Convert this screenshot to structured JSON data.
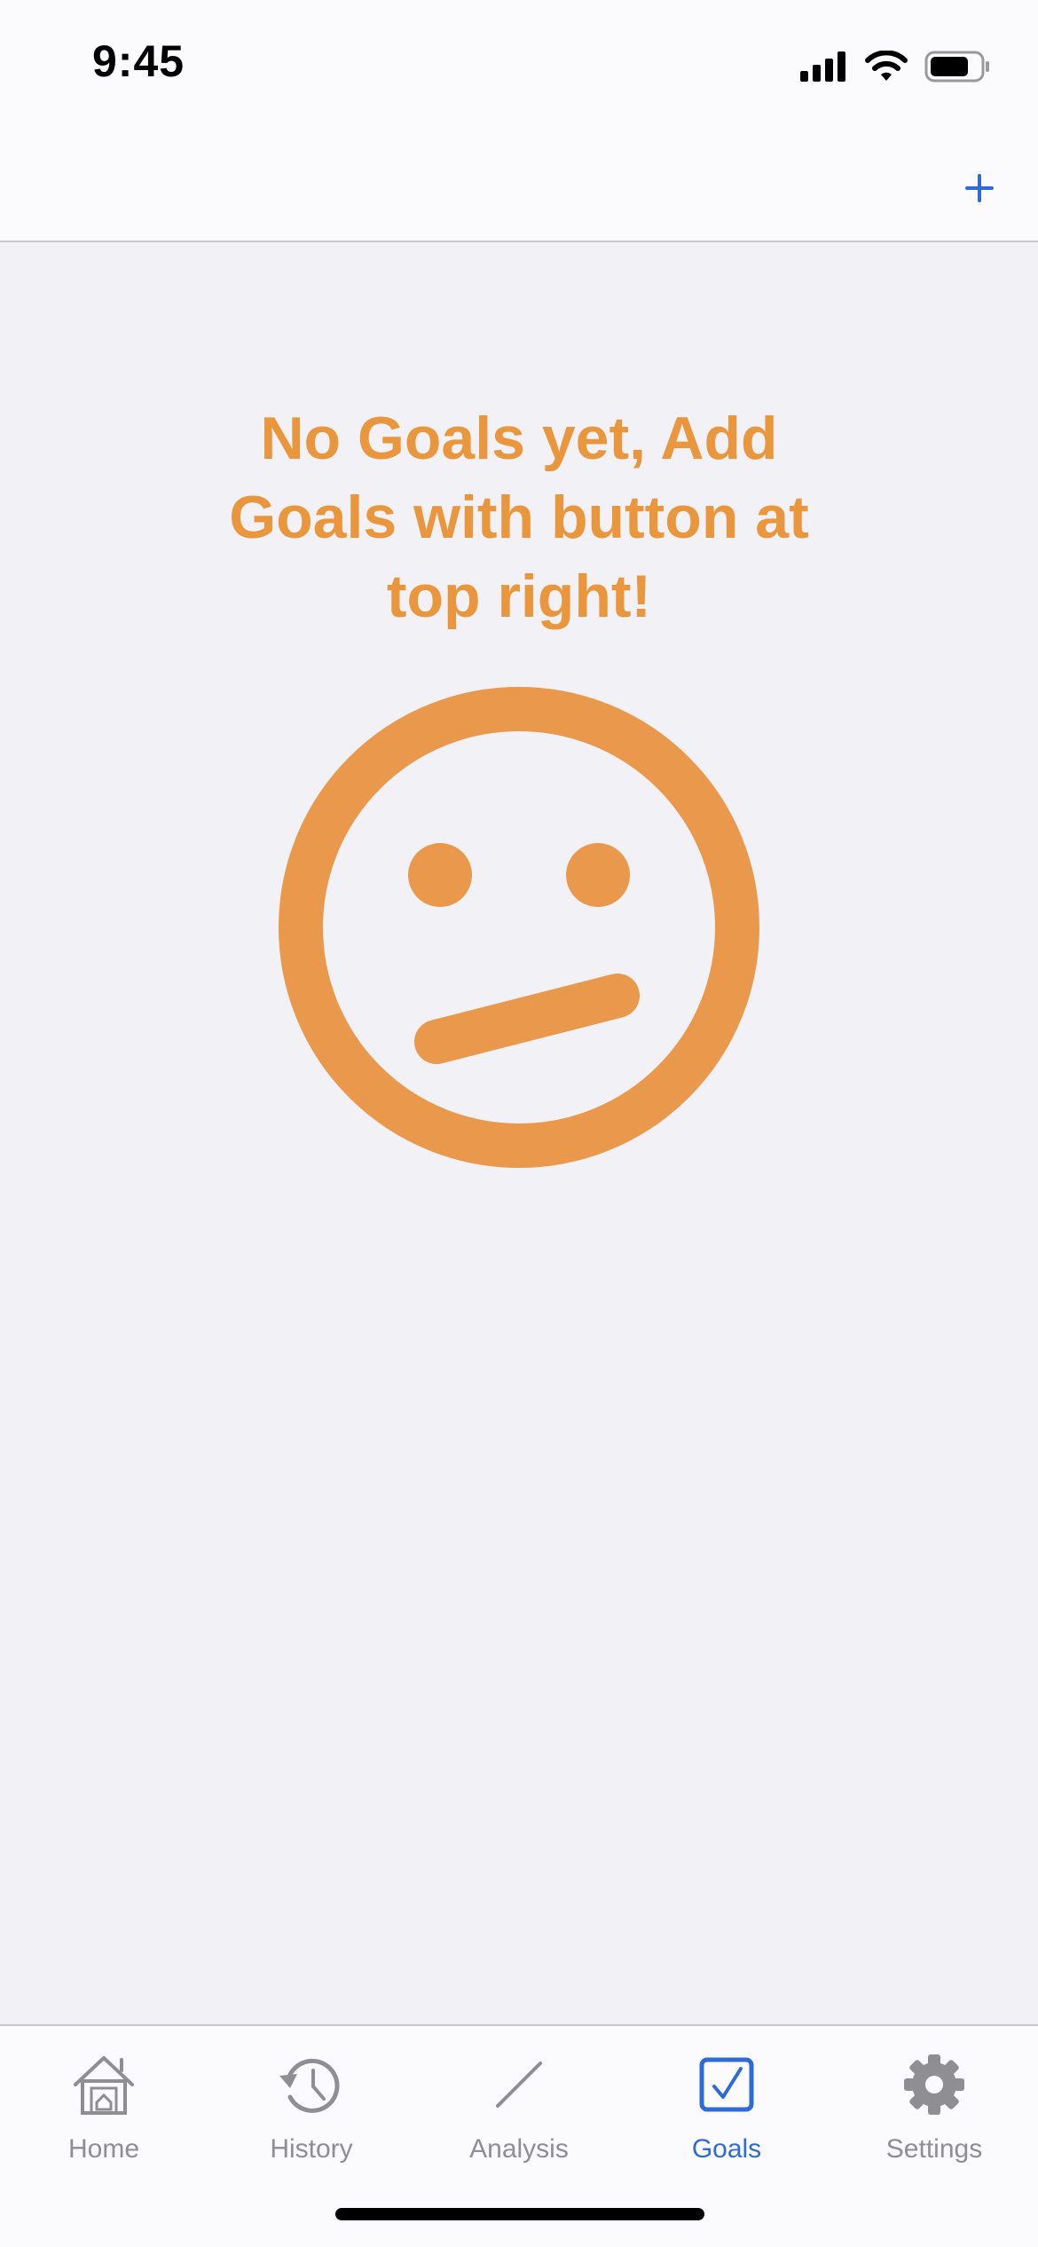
{
  "status_bar": {
    "time": "9:45",
    "icons": [
      "cellular-signal-icon",
      "wifi-icon",
      "battery-icon"
    ]
  },
  "nav_bar": {
    "add_button_icon": "plus-icon"
  },
  "empty_state": {
    "message": "No Goals yet, Add Goals with button at top right!",
    "icon": "confused-face-icon"
  },
  "tab_bar": {
    "tabs": [
      {
        "label": "Home",
        "icon": "house-icon",
        "active": false
      },
      {
        "label": "History",
        "icon": "clock-history-icon",
        "active": false
      },
      {
        "label": "Analysis",
        "icon": "line-chart-icon",
        "active": false
      },
      {
        "label": "Goals",
        "icon": "checkbox-icon",
        "active": true
      },
      {
        "label": "Settings",
        "icon": "gear-icon",
        "active": false
      }
    ]
  },
  "colors": {
    "accent": "#2e6bd8",
    "empty_state": "#e9963d",
    "inactive_tab": "#8e8e93",
    "background": "#f2f1f6"
  }
}
